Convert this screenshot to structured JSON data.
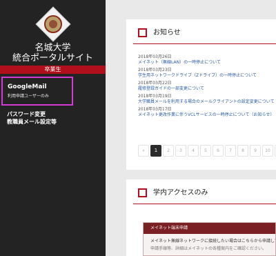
{
  "sidebar": {
    "logo_icon": "university-seal-icon",
    "title_line1": "名城大学",
    "title_line2": "統合ポータルサイト",
    "alumni_label": "卒業生",
    "gmail": {
      "title": "GoogleMail",
      "subtitle": "利用申請ユーザーのみ"
    },
    "password_line1": "パスワード変更",
    "password_line2": "教職員メール設定等"
  },
  "news_panel": {
    "title": "お知らせ",
    "items": [
      {
        "date": "2018年03月26日",
        "text": "メイネット（無線LAN）の一時停止について"
      },
      {
        "date": "2018年03月23日",
        "text": "学生用ネットワークドライブ（Zドライブ）の一時停止について"
      },
      {
        "date": "2018年03月22日",
        "text": "履修登録ガイドの一部変更について"
      },
      {
        "date": "2018年03月19日",
        "text": "大学職員メールを利用する場合のメールクライアントの設定変更について"
      },
      {
        "date": "2018年03月17日",
        "text": "メイネット更改作業に伴うVCLサービスの一時停止について（お知らせ）"
      }
    ],
    "pagination": [
      "«",
      "1",
      "2",
      "3",
      "4",
      "5",
      "6",
      "7",
      "8",
      "9",
      "10",
      "»"
    ],
    "current_page": "1"
  },
  "access_panel": {
    "title": "学内アクセスのみ",
    "notice_header": "メイネット端末申請",
    "notice_body": "メイネット無線ネットワークに接続したい場合はこちらから申請してください。",
    "notice_body2": "申請手順等、詳細はメイネットの各種案内をご確認ください。"
  },
  "colors": {
    "accent": "#b10f1b",
    "sidebar_bg": "#232323",
    "highlight_border": "#d63ad6",
    "link": "#2a5aa8"
  }
}
